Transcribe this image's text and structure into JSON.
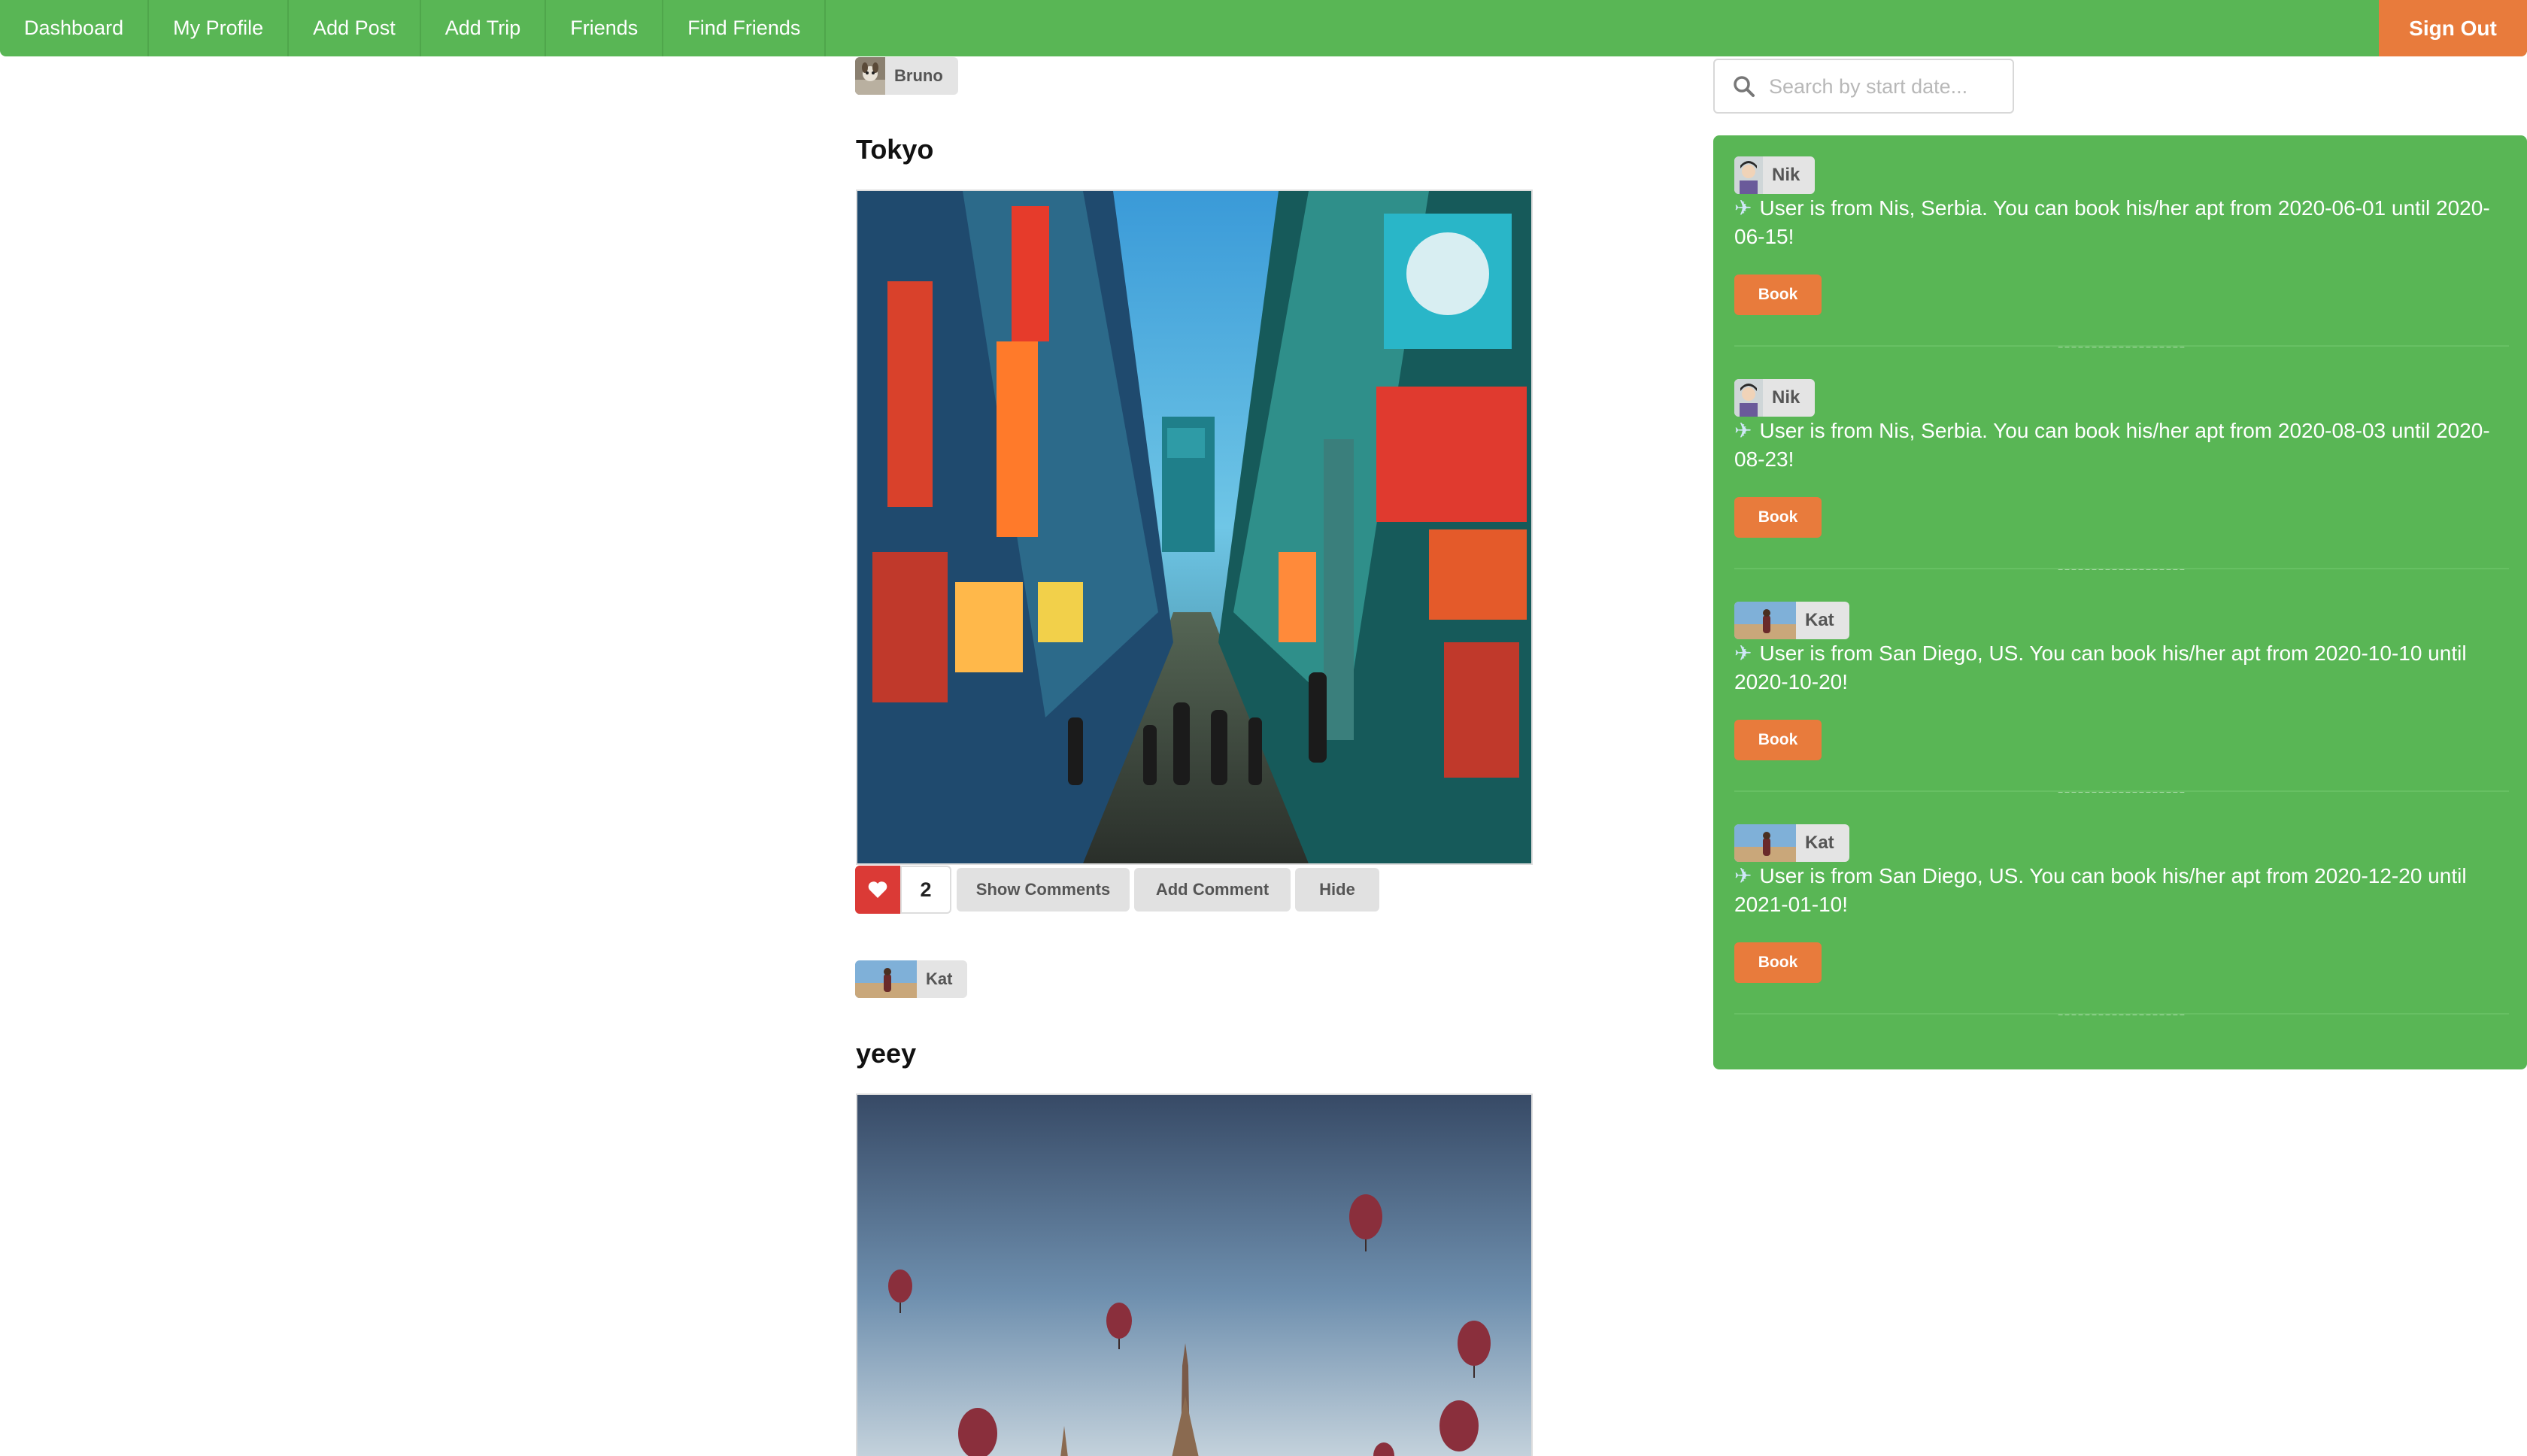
{
  "nav": {
    "items": [
      "Dashboard",
      "My Profile",
      "Add Post",
      "Add Trip",
      "Friends",
      "Find Friends"
    ],
    "sign_out": "Sign Out"
  },
  "feed": {
    "posts": [
      {
        "author": "Bruno",
        "title": "Tokyo",
        "likes": "2",
        "show_comments": "Show Comments",
        "add_comment": "Add Comment",
        "hide": "Hide"
      },
      {
        "author": "Kat",
        "title": "yeey"
      }
    ]
  },
  "search": {
    "placeholder": "Search by start date..."
  },
  "trips": [
    {
      "user": "Nik",
      "text": "User is from Nis, Serbia. You can book his/her apt from 2020-06-01 until 2020-06-15!",
      "book": "Book",
      "separator": "-------------------"
    },
    {
      "user": "Nik",
      "text": "User is from Nis, Serbia. You can book his/her apt from 2020-08-03 until 2020-08-23!",
      "book": "Book",
      "separator": "-------------------"
    },
    {
      "user": "Kat",
      "text": "User is from San Diego, US. You can book his/her apt from 2020-10-10 until 2020-10-20!",
      "book": "Book",
      "separator": "-------------------"
    },
    {
      "user": "Kat",
      "text": "User is from San Diego, US. You can book his/her apt from 2020-12-20 until 2021-01-10!",
      "book": "Book",
      "separator": "-------------------"
    }
  ],
  "icons": {
    "search": "search-icon",
    "like": "heart-icon",
    "trip": "airplane-icon"
  },
  "colors": {
    "brand_green": "#59b655",
    "accent_orange": "#e87b3c",
    "like_red": "#db3a36"
  }
}
